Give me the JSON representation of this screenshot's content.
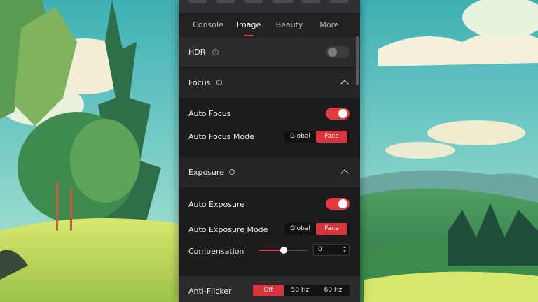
{
  "tabs": [
    {
      "label": "Console",
      "active": false
    },
    {
      "label": "Image",
      "active": true
    },
    {
      "label": "Beauty",
      "active": false
    },
    {
      "label": "More",
      "active": false
    }
  ],
  "hdr": {
    "label": "HDR",
    "info_icon": "question-circle-icon",
    "enabled": false
  },
  "focus": {
    "title": "Focus",
    "icon": "refresh-icon",
    "expanded": true,
    "auto_focus": {
      "label": "Auto Focus",
      "enabled": true
    },
    "auto_focus_mode": {
      "label": "Auto Focus Mode",
      "options": [
        "Global",
        "Face"
      ],
      "selected": "Face"
    }
  },
  "exposure": {
    "title": "Exposure",
    "icon": "refresh-icon",
    "expanded": true,
    "auto_exposure": {
      "label": "Auto Exposure",
      "enabled": true
    },
    "auto_exposure_mode": {
      "label": "Auto Exposure Mode",
      "options": [
        "Global",
        "Face"
      ],
      "selected": "Face"
    },
    "compensation": {
      "label": "Compensation",
      "value": "0",
      "slider_fraction": 0.5
    }
  },
  "anti_flicker": {
    "label": "Anti-Flicker",
    "options": [
      "Off",
      "50 Hz",
      "60 Hz"
    ],
    "selected": "Off"
  },
  "colors": {
    "accent": "#e2383f",
    "panel": "#2b2b2e",
    "section_body": "#1c1c1f"
  }
}
